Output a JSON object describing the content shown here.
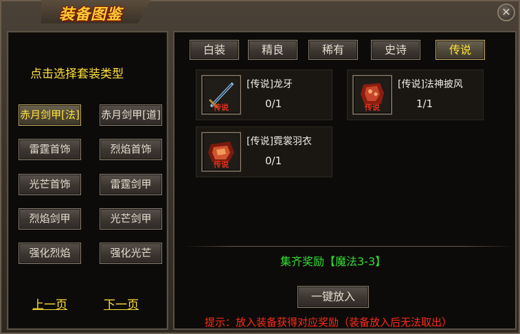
{
  "window": {
    "title": "装备图鉴",
    "close_label": "✕"
  },
  "left": {
    "prompt": "点击选择套装类型",
    "suits": [
      "赤月剑甲[法]",
      "赤月剑甲[道]",
      "雷霆首饰",
      "烈焰首饰",
      "光芒首饰",
      "雷霆剑甲",
      "烈焰剑甲",
      "光芒剑甲",
      "强化烈焰",
      "强化光芒"
    ],
    "selected_suit": "赤月剑甲[法]",
    "prev_page": "上一页",
    "next_page": "下一页"
  },
  "tabs": [
    "白装",
    "精良",
    "稀有",
    "史诗",
    "传说"
  ],
  "selected_tab": "传说",
  "items": [
    {
      "name": "[传说]龙牙",
      "count": "0/1",
      "badge": "传说",
      "icon": "dragon-fang-sword-icon"
    },
    {
      "name": "[传说]法神披风",
      "count": "1/1",
      "badge": "传说",
      "icon": "mage-cloak-icon"
    },
    {
      "name": "[传说]霓裳羽衣",
      "count": "0/1",
      "badge": "传说",
      "icon": "feather-robe-icon"
    }
  ],
  "reward": "集齐奖励【魔法3-3】",
  "action_button": "一键放入",
  "tip": "提示：放入装备获得对应奖励（装备放入后无法取出）",
  "colors": {
    "accent_yellow": "#ffe23a",
    "reward_green": "#33dd33",
    "tip_red": "#ff2a1a",
    "badge_red": "#e8301a"
  }
}
